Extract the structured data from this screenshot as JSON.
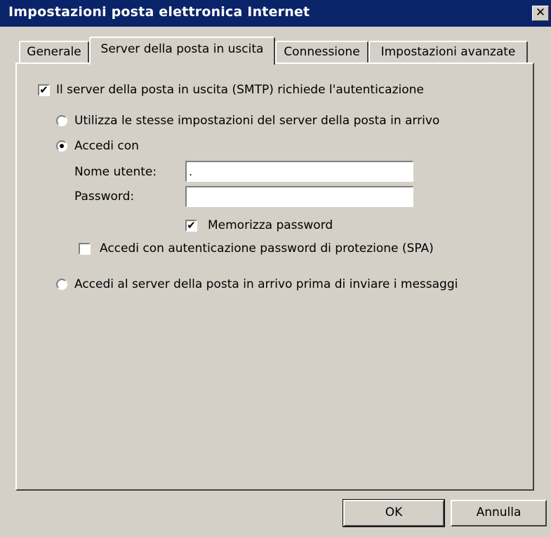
{
  "window": {
    "title": "Impostazioni posta elettronica Internet",
    "close_label": "✕"
  },
  "tabs": [
    {
      "label": "Generale",
      "active": false
    },
    {
      "label": "Server della posta in uscita",
      "active": true
    },
    {
      "label": "Connessione",
      "active": false
    },
    {
      "label": "Impostazioni avanzate",
      "active": false
    }
  ],
  "smtp_auth": {
    "label": "Il server della posta in uscita (SMTP) richiede l'autenticazione",
    "checked": true
  },
  "options": {
    "same_settings_label": "Utilizza le stesse impostazioni del server della posta in arrivo",
    "login_with_label": "Accedi con",
    "selected": "login_with",
    "login_before_send_label": "Accedi al server della posta in arrivo prima di inviare i messaggi"
  },
  "credentials": {
    "username_label": "Nome utente:",
    "username_value": ".",
    "password_label": "Password:",
    "password_value": "",
    "remember_password_label": "Memorizza password",
    "remember_password_checked": true,
    "spa_label": "Accedi con autenticazione password di protezione (SPA)",
    "spa_checked": false
  },
  "buttons": {
    "ok_label": "OK",
    "cancel_label": "Annulla"
  },
  "check_glyph": "✔"
}
